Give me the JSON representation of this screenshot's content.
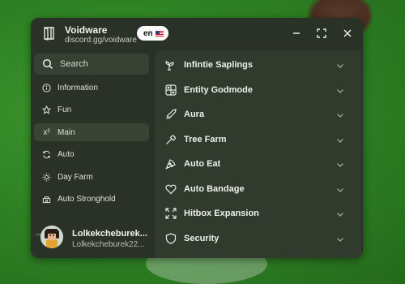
{
  "window": {
    "title": "Voidware",
    "subtitle": "discord.gg/voidware",
    "language": "en",
    "controls": [
      "minimize",
      "maximize",
      "close"
    ]
  },
  "sidebar": {
    "search_placeholder": "Search",
    "items": [
      {
        "label": "Information",
        "icon": "info-icon"
      },
      {
        "label": "Fun",
        "icon": "star-icon"
      },
      {
        "label": "Main",
        "icon": "superscript-x2-icon",
        "active": true
      },
      {
        "label": "Auto",
        "icon": "refresh-icon"
      },
      {
        "label": "Day Farm",
        "icon": "sun-icon"
      },
      {
        "label": "Auto Stronghold",
        "icon": "stronghold-icon"
      }
    ]
  },
  "user": {
    "display_name": "Lolkekcheburek...",
    "username": "Lolkekcheburek22..."
  },
  "content": {
    "sections": [
      {
        "label": "Infintie Saplings",
        "icon": "sprout-icon"
      },
      {
        "label": "Entity Godmode",
        "icon": "grid-icon"
      },
      {
        "label": "Aura",
        "icon": "sword-icon"
      },
      {
        "label": "Tree Farm",
        "icon": "axe-icon"
      },
      {
        "label": "Auto Eat",
        "icon": "pizza-icon"
      },
      {
        "label": "Auto Bandage",
        "icon": "heart-icon"
      },
      {
        "label": "Hitbox Expansion",
        "icon": "expand-icon"
      },
      {
        "label": "Security",
        "icon": "shield-icon"
      }
    ]
  },
  "colors": {
    "window_bg": "#2a3127",
    "content_bg": "#303a2d",
    "active_item_bg": "#394435"
  }
}
